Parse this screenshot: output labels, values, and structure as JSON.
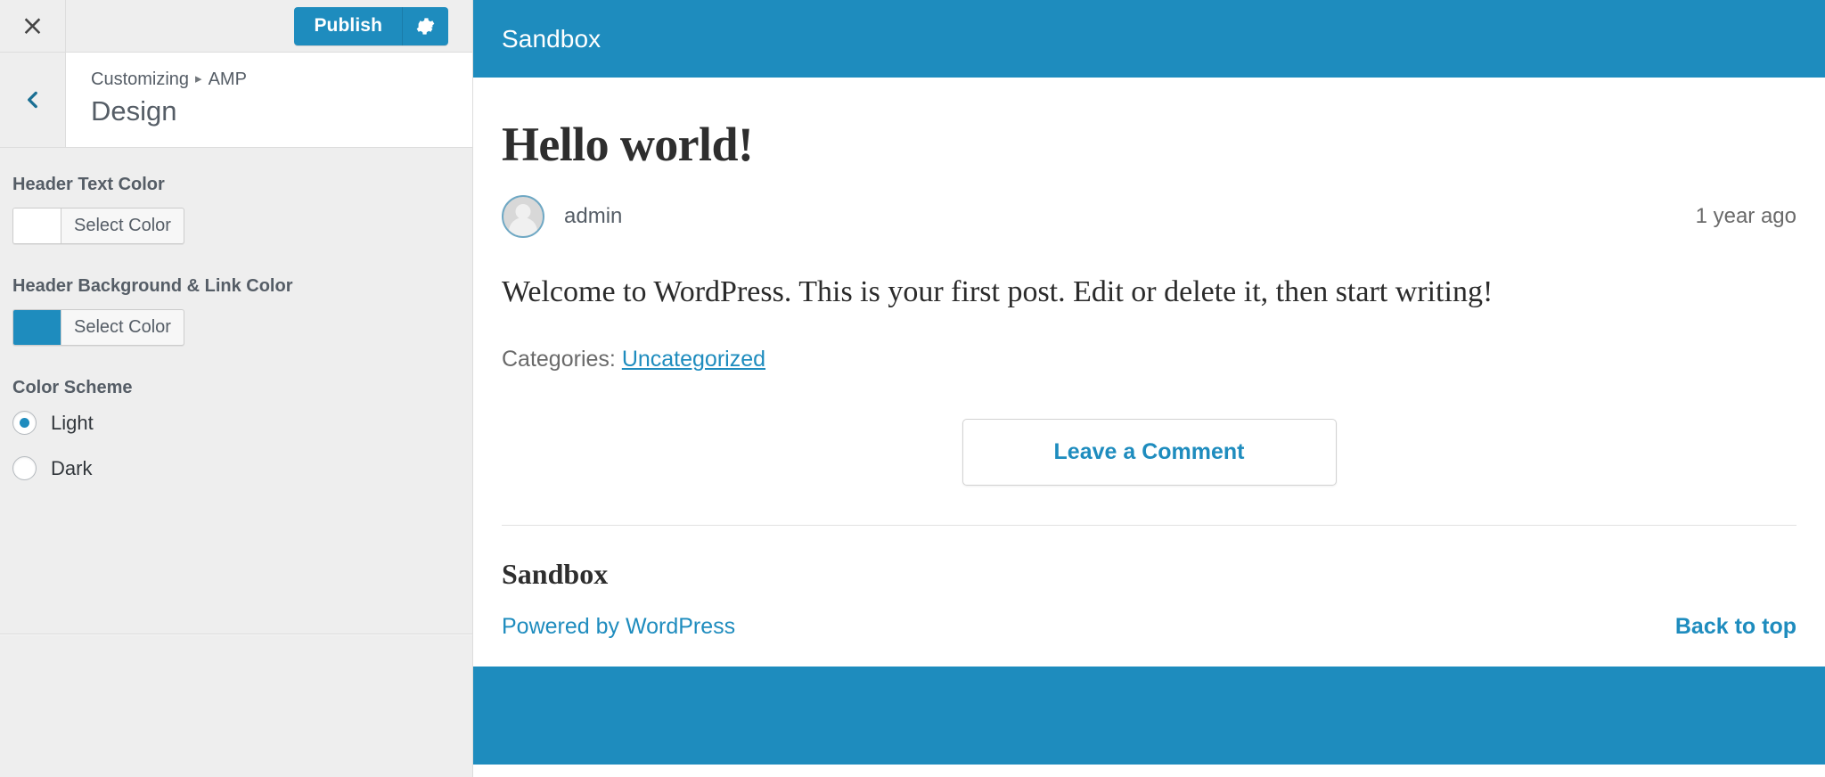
{
  "customizer": {
    "close_label": "×",
    "close_icon": "close-icon",
    "publish_label": "Publish",
    "gear_icon": "gear-icon",
    "back_icon": "chevron-left-icon",
    "breadcrumb_root": "Customizing",
    "breadcrumb_separator": "▸",
    "breadcrumb_section": "AMP",
    "panel_title": "Design",
    "controls": [
      {
        "label": "Header Text Color",
        "type": "color",
        "swatch": "#ffffff",
        "button_label": "Select Color"
      },
      {
        "label": "Header Background & Link Color",
        "type": "color",
        "swatch": "#1e8cbe",
        "button_label": "Select Color"
      }
    ],
    "color_scheme": {
      "label": "Color Scheme",
      "options": [
        {
          "label": "Light",
          "checked": true
        },
        {
          "label": "Dark",
          "checked": false
        }
      ]
    }
  },
  "preview": {
    "site_title": "Sandbox",
    "post": {
      "title": "Hello world!",
      "author": "admin",
      "time": "1 year ago",
      "body": "Welcome to WordPress. This is your first post. Edit or delete it, then start writing!",
      "categories_label": "Categories:",
      "category": "Uncategorized",
      "comment_button": "Leave a Comment"
    },
    "footer": {
      "title": "Sandbox",
      "powered_by": "Powered by WordPress",
      "back_to_top": "Back to top"
    }
  },
  "colors": {
    "accent": "#1e8cbe",
    "sidebar_bg": "#eeeeee",
    "text": "#555d66"
  }
}
